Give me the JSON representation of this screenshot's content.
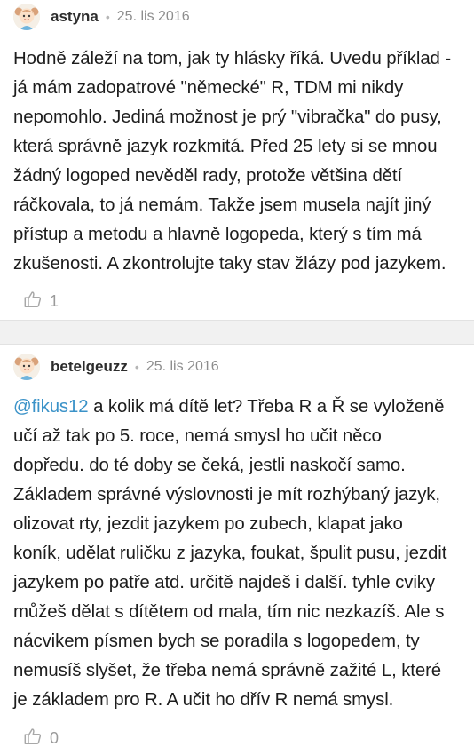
{
  "posts": [
    {
      "author": "astyna",
      "separator": "•",
      "date": "25. lis 2016",
      "mention": "",
      "text": "Hodně záleží na tom, jak ty hlásky říká. Uvedu příklad -\njá mám zadopatrové \"německé\" R, TDM mi nikdy\nnepomohlo. Jediná možnost je prý \"vibračka\" do pusy,\nkterá správně jazyk rozkmitá. Před 25 lety si se mnou\nžádný logoped nevěděl rady, protože většina dětí\nráčkovala, to já nemám. Takže jsem musela najít jiný\npřístup a metodu a hlavně logopeda, který s tím má\nzkušenosti. A zkontrolujte taky stav žlázy pod jazykem.",
      "likes": "1",
      "avatar_icon": "girl-avatar-icon",
      "like_icon": "thumbs-up-icon"
    },
    {
      "author": "betelgeuzz",
      "separator": "•",
      "date": "25. lis 2016",
      "mention": "@fikus12",
      "text": " a kolik má dítě let? Třeba R a Ř se vyloženě\nučí až tak po 5. roce, nemá smysl ho učit něco\ndopředu. do té doby se čeká, jestli naskočí samo.\nZákladem správné výslovnosti je mít rozhýbaný jazyk,\nolizovat rty, jezdit jazykem po zubech, klapat jako\nkoník, udělat ruličku z jazyka, foukat, špulit pusu, jezdit\njazykem po patře atd. určitě najdeš i další. tyhle cviky\nmůžeš dělat s dítětem od mala, tím nic nezkazíš. Ale s\nnácvikem písmen bych se poradila s logopedem, ty\nnemusíš slyšet, že třeba nemá správně zažité L, které\nje základem pro R. A učit ho dřív R nemá smysl.",
      "likes": "0",
      "avatar_icon": "girl-avatar-icon",
      "like_icon": "thumbs-up-icon"
    }
  ],
  "colors": {
    "mention": "#3a92c8",
    "separator_bg": "#f1f1f1",
    "meta_text": "#8d8d8d"
  }
}
